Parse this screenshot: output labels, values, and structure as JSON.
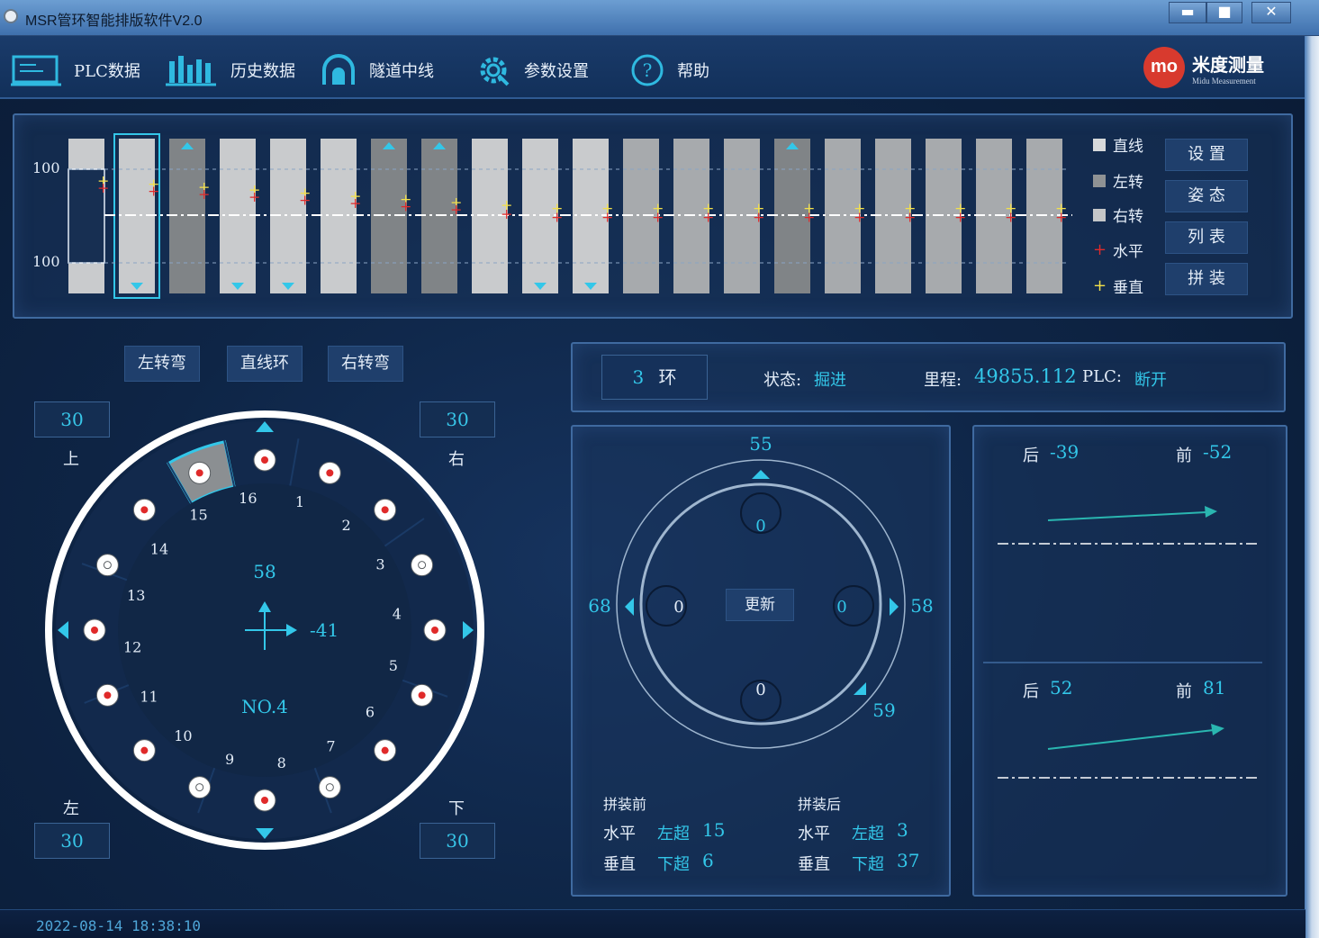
{
  "window": {
    "title": "MSR管环智能排版软件V2.0",
    "minimize": "▬",
    "maximize": "■",
    "close": "✕"
  },
  "menu": {
    "plc": "PLC数据",
    "history": "历史数据",
    "tunnel": "隧道中线",
    "params": "参数设置",
    "help": "帮助"
  },
  "brand": {
    "logo": "mo",
    "name": "米度测量",
    "sub": "Midu Measurement"
  },
  "ring_strip": {
    "top_label": "100",
    "bottom_label": "100",
    "bars": [
      {
        "shade": "light",
        "selected": false,
        "up": false,
        "down": false
      },
      {
        "shade": "light",
        "selected": true,
        "up": false,
        "down": true
      },
      {
        "shade": "dark",
        "selected": false,
        "up": true,
        "down": false
      },
      {
        "shade": "light",
        "selected": false,
        "up": false,
        "down": true
      },
      {
        "shade": "light",
        "selected": false,
        "up": false,
        "down": true
      },
      {
        "shade": "light",
        "selected": false,
        "up": false,
        "down": false
      },
      {
        "shade": "dark",
        "selected": false,
        "up": true,
        "down": false
      },
      {
        "shade": "dark",
        "selected": false,
        "up": true,
        "down": false
      },
      {
        "shade": "light",
        "selected": false,
        "up": false,
        "down": false
      },
      {
        "shade": "light",
        "selected": false,
        "up": false,
        "down": true
      },
      {
        "shade": "light",
        "selected": false,
        "up": false,
        "down": true
      },
      {
        "shade": "mid",
        "selected": false,
        "up": false,
        "down": false
      },
      {
        "shade": "mid",
        "selected": false,
        "up": false,
        "down": false
      },
      {
        "shade": "mid",
        "selected": false,
        "up": false,
        "down": false
      },
      {
        "shade": "dark",
        "selected": false,
        "up": true,
        "down": false
      },
      {
        "shade": "mid",
        "selected": false,
        "up": false,
        "down": false
      },
      {
        "shade": "mid",
        "selected": false,
        "up": false,
        "down": false
      },
      {
        "shade": "mid",
        "selected": false,
        "up": false,
        "down": false
      },
      {
        "shade": "mid",
        "selected": false,
        "up": false,
        "down": false
      },
      {
        "shade": "mid",
        "selected": false,
        "up": false,
        "down": false
      }
    ],
    "legend": {
      "straight": "直线",
      "left": "左转",
      "right": "右转",
      "horizontal": "水平",
      "vertical": "垂直"
    },
    "buttons": {
      "settings": "设 置",
      "pose": "姿 态",
      "list": "列 表",
      "assemble": "拼 装"
    }
  },
  "ring_types": {
    "left_turn": "左转弯",
    "straight": "直线环",
    "right_turn": "右转弯"
  },
  "ring_view": {
    "top_value": "30",
    "top_label": "上",
    "right_value": "30",
    "right_label": "右",
    "left_label": "左",
    "left_value": "30",
    "bottom_label": "下",
    "bottom_value": "30",
    "center_value": "58",
    "offset_value": "-41",
    "ring_name": "NO.4",
    "segments": [
      "1",
      "2",
      "3",
      "4",
      "5",
      "6",
      "7",
      "8",
      "9",
      "10",
      "11",
      "12",
      "13",
      "14",
      "15",
      "16"
    ]
  },
  "status_bar": {
    "ring_no": "3",
    "ring_unit": "环",
    "state_label": "状态:",
    "state_value": "掘进",
    "mileage_label": "里程:",
    "mileage_value": "49855.112",
    "plc_label": "PLC:",
    "plc_value": "断开"
  },
  "gap_view": {
    "top": "55",
    "left": "68",
    "right": "58",
    "bottom_right": "59",
    "cyl_top": "0",
    "cyl_left": "0",
    "cyl_right": "0",
    "cyl_bottom": "0",
    "update": "更新",
    "before_title": "拼装前",
    "after_title": "拼装后",
    "before": {
      "h_label": "水平",
      "h_dir": "左超",
      "h_val": "15",
      "v_label": "垂直",
      "v_dir": "下超",
      "v_val": "6"
    },
    "after": {
      "h_label": "水平",
      "h_dir": "左超",
      "h_val": "3",
      "v_label": "垂直",
      "v_dir": "下超",
      "v_val": "37"
    }
  },
  "trend": {
    "top": {
      "back_label": "后",
      "back_val": "-39",
      "front_label": "前",
      "front_val": "-52"
    },
    "bottom": {
      "back_label": "后",
      "back_val": "52",
      "front_label": "前",
      "front_val": "81"
    }
  },
  "footer": {
    "datetime": "2022-08-14 18:38:10"
  },
  "colors": {
    "accent": "#33c7e9",
    "panel_border": "#3f6aa0",
    "marker_red": "#e02a2a",
    "marker_yellow": "#f2e04a"
  }
}
